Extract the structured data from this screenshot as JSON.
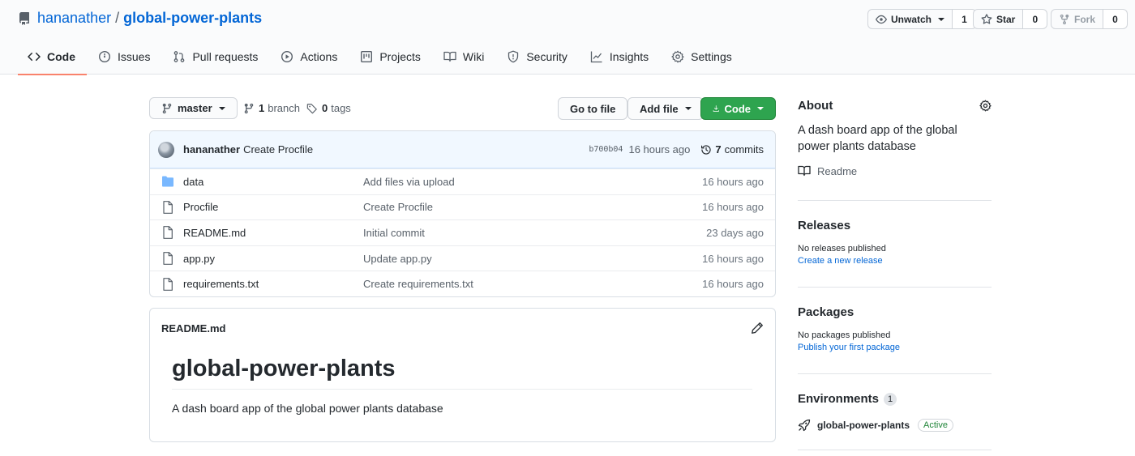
{
  "repo": {
    "owner": "hananather",
    "separator": "/",
    "name": "global-power-plants"
  },
  "actions": {
    "watch": {
      "label": "Unwatch",
      "count": "1"
    },
    "star": {
      "label": "Star",
      "count": "0"
    },
    "fork": {
      "label": "Fork",
      "count": "0"
    }
  },
  "tabs": [
    {
      "label": "Code",
      "icon": "code-icon",
      "selected": true
    },
    {
      "label": "Issues",
      "icon": "issue-icon"
    },
    {
      "label": "Pull requests",
      "icon": "pull-request-icon"
    },
    {
      "label": "Actions",
      "icon": "play-icon"
    },
    {
      "label": "Projects",
      "icon": "project-icon"
    },
    {
      "label": "Wiki",
      "icon": "book-icon"
    },
    {
      "label": "Security",
      "icon": "shield-icon"
    },
    {
      "label": "Insights",
      "icon": "graph-icon"
    },
    {
      "label": "Settings",
      "icon": "gear-icon"
    }
  ],
  "file_nav": {
    "branch": "master",
    "branch_count": "1",
    "branch_label": "branch",
    "tag_count": "0",
    "tag_label": "tags",
    "go_to_file": "Go to file",
    "add_file": "Add file",
    "code": "Code"
  },
  "latest_commit": {
    "author": "hananather",
    "message": "Create Procfile",
    "sha": "b700b04",
    "time": "16 hours ago",
    "commit_count": "7",
    "commits_label": "commits"
  },
  "files": [
    {
      "type": "directory",
      "name": "data",
      "message": "Add files via upload",
      "age": "16 hours ago"
    },
    {
      "type": "file",
      "name": "Procfile",
      "message": "Create Procfile",
      "age": "16 hours ago"
    },
    {
      "type": "file",
      "name": "README.md",
      "message": "Initial commit",
      "age": "23 days ago"
    },
    {
      "type": "file",
      "name": "app.py",
      "message": "Update app.py",
      "age": "16 hours ago"
    },
    {
      "type": "file",
      "name": "requirements.txt",
      "message": "Create requirements.txt",
      "age": "16 hours ago"
    }
  ],
  "readme": {
    "filename": "README.md",
    "heading": "global-power-plants",
    "paragraph": "A dash board app of the global power plants database"
  },
  "sidebar": {
    "about_title": "About",
    "about_desc": "A dash board app of the global power plants database",
    "readme_link": "Readme",
    "releases_title": "Releases",
    "releases_none": "No releases published",
    "releases_link": "Create a new release",
    "packages_title": "Packages",
    "packages_none": "No packages published",
    "packages_link": "Publish your first package",
    "environments_title": "Environments",
    "environments_count": "1",
    "environment_name": "global-power-plants",
    "environment_status": "Active"
  },
  "colors": {
    "link": "#0366d6",
    "primary_button": "#2ea44f",
    "tab_underline": "#f9826c",
    "commit_bar": "#f1f8ff"
  }
}
